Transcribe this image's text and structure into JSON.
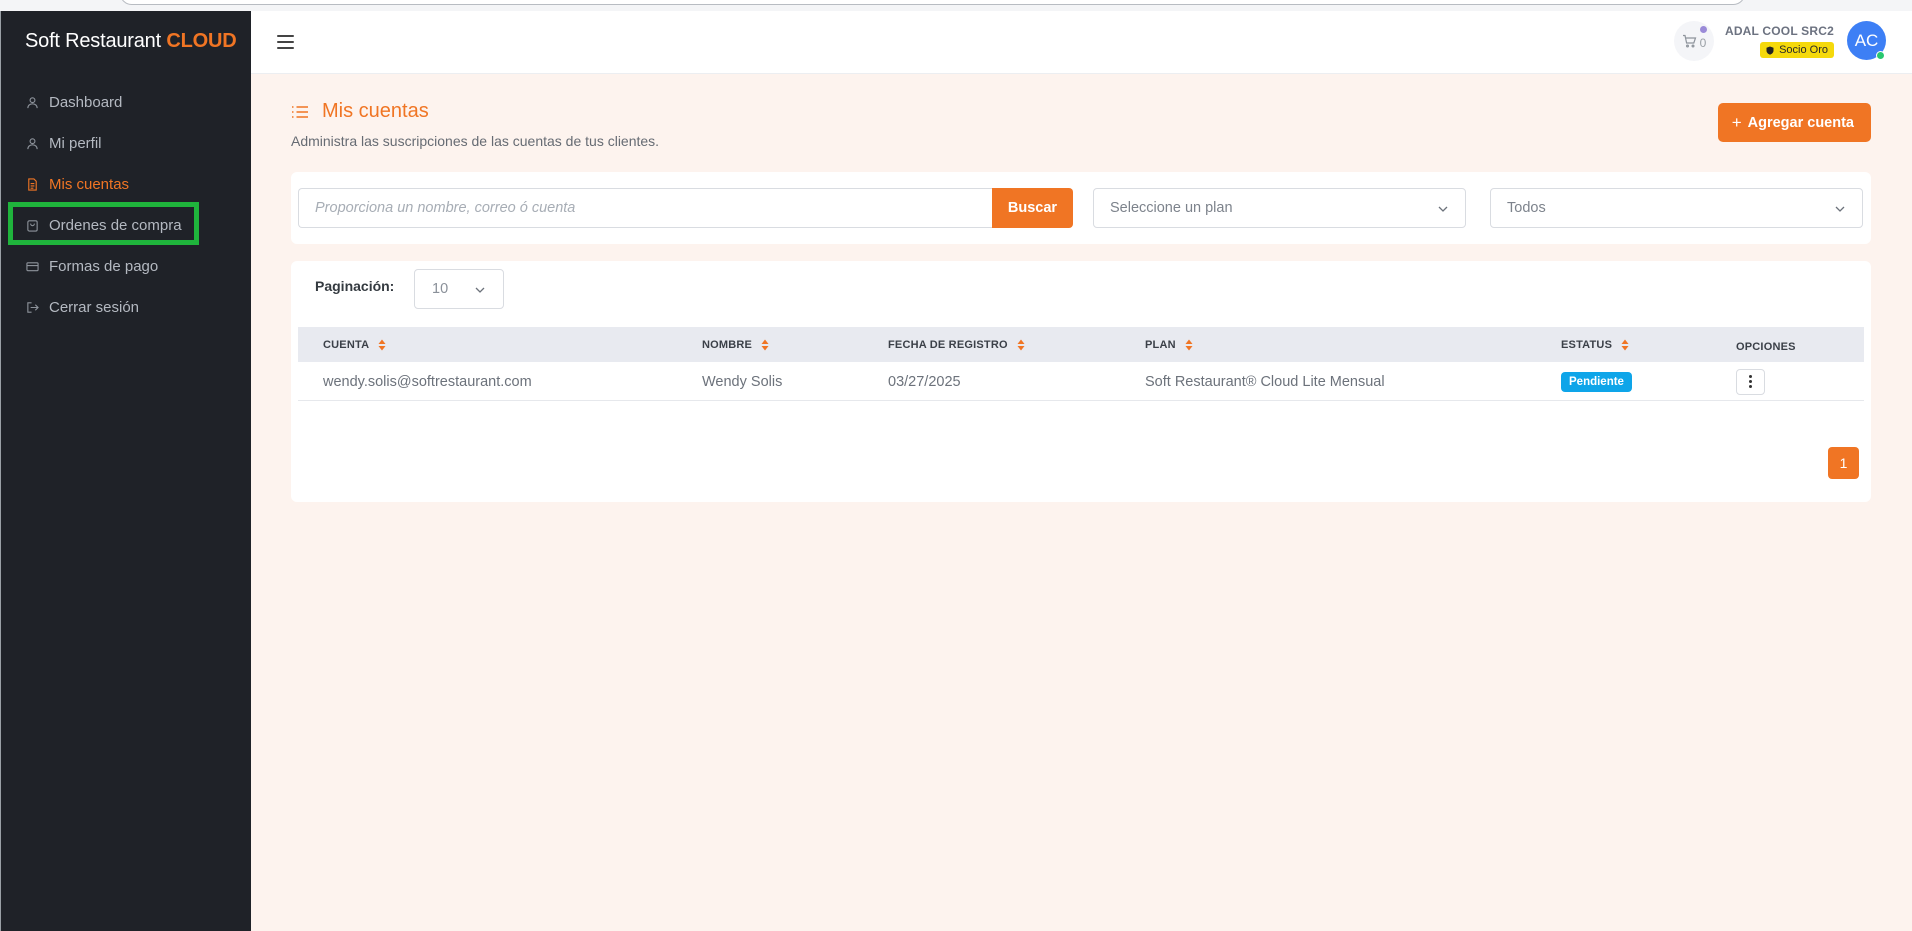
{
  "brand": {
    "name": "Soft Restaurant",
    "accent": "CLOUD"
  },
  "sidebar": {
    "items": [
      {
        "label": "Dashboard",
        "icon": "user-icon"
      },
      {
        "label": "Mi perfil",
        "icon": "user-icon"
      },
      {
        "label": "Mis cuentas",
        "icon": "document-icon",
        "active": true
      },
      {
        "label": "Ordenes de compra",
        "icon": "shopping-bag-icon",
        "highlighted": true
      },
      {
        "label": "Formas de pago",
        "icon": "credit-card-icon"
      },
      {
        "label": "Cerrar sesión",
        "icon": "logout-icon"
      }
    ]
  },
  "header": {
    "cart_count": "0",
    "username": "ADAL COOL SRC2",
    "tier_badge": "Socio Oro",
    "avatar_initials": "AC"
  },
  "page": {
    "title": "Mis cuentas",
    "subtitle": "Administra las suscripciones de las cuentas de tus clientes.",
    "add_button": "Agregar cuenta",
    "add_button_icon": "+"
  },
  "filters": {
    "search_placeholder": "Proporciona un nombre, correo ó cuenta",
    "search_button": "Buscar",
    "plan_select": "Seleccione un plan",
    "status_select": "Todos"
  },
  "pagination": {
    "label": "Paginación:",
    "page_size": "10",
    "current_page": "1"
  },
  "table": {
    "columns": [
      "CUENTA",
      "NOMBRE",
      "FECHA DE REGISTRO",
      "PLAN",
      "ESTATUS",
      "OPCIONES"
    ],
    "rows": [
      {
        "cuenta": "wendy.solis@softrestaurant.com",
        "nombre": "Wendy Solis",
        "fecha": "03/27/2025",
        "plan": "Soft Restaurant® Cloud Lite Mensual",
        "estatus": "Pendiente"
      }
    ]
  },
  "colors": {
    "accent": "#f07524",
    "sidebar_bg": "#1f2228",
    "main_bg": "#fdf3ee",
    "status_pending": "#0ea5e9",
    "highlight": "#1fb43c",
    "gold_badge": "#f5d90c",
    "avatar": "#3d7ff5"
  }
}
